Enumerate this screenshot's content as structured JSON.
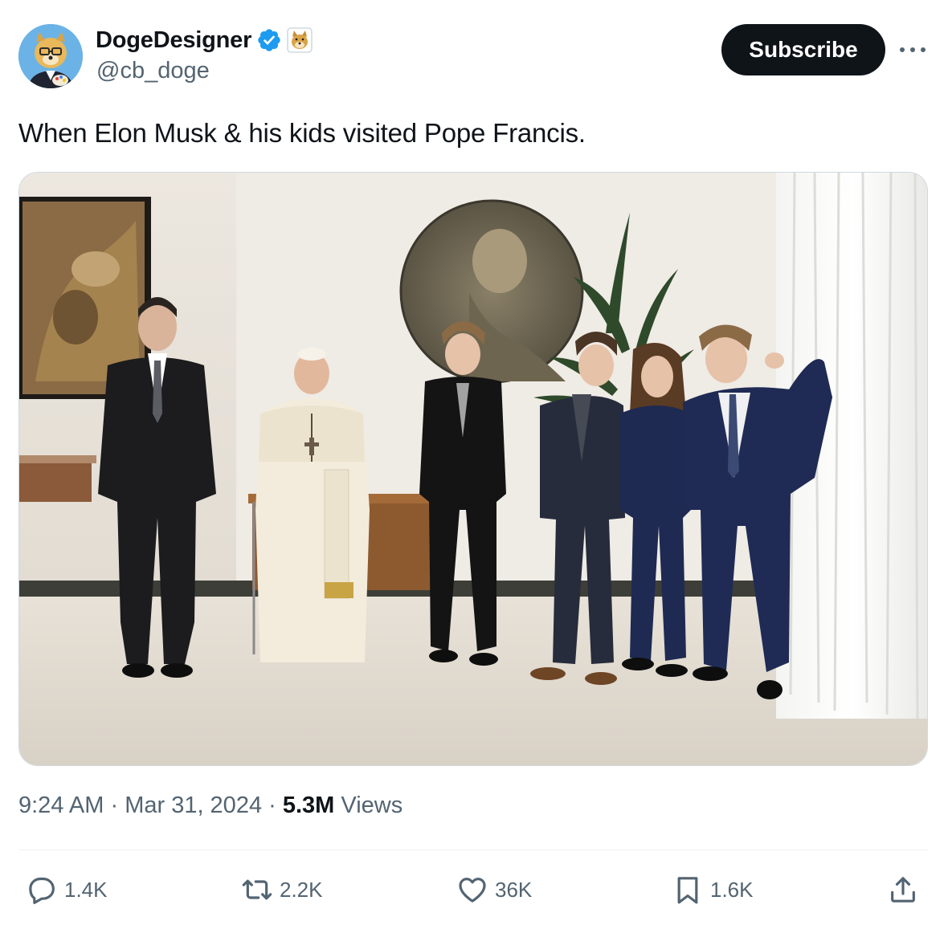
{
  "author": {
    "display_name": "DogeDesigner",
    "handle": "@cb_doge",
    "verified": true,
    "avatar_icon": "doge-avatar-icon",
    "badge_icon": "doge-affiliate-badge-icon"
  },
  "header": {
    "subscribe_label": "Subscribe",
    "more_icon": "more-icon"
  },
  "tweet": {
    "text": "When Elon Musk & his kids visited Pope Francis."
  },
  "media": {
    "type": "photo"
  },
  "meta": {
    "time": "9:24 AM",
    "sep1": " · ",
    "date": "Mar 31, 2024",
    "sep2": " · ",
    "views_count": "5.3M",
    "views_label": " Views"
  },
  "actions": {
    "reply": {
      "icon": "reply-icon",
      "count": "1.4K"
    },
    "repost": {
      "icon": "repost-icon",
      "count": "2.2K"
    },
    "like": {
      "icon": "heart-icon",
      "count": "36K"
    },
    "bookmark": {
      "icon": "bookmark-icon",
      "count": "1.6K"
    },
    "share": {
      "icon": "share-icon"
    }
  },
  "colors": {
    "text": "#0f1419",
    "secondary": "#536471",
    "verified_blue": "#1d9bf0",
    "button_bg": "#0f1419",
    "divider": "#eff3f4"
  }
}
